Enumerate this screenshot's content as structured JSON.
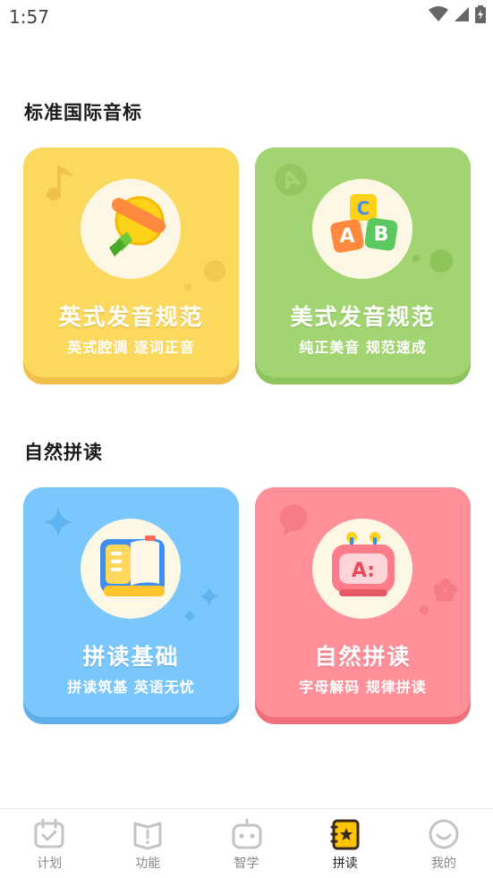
{
  "status_bar": {
    "time": "1:57"
  },
  "sections": [
    {
      "title": "标准国际音标",
      "cards": [
        {
          "title": "英式发音规范",
          "subtitle": "英式腔调 逐词正音",
          "icon": "bell-icon",
          "color": "#fbd95e"
        },
        {
          "title": "美式发音规范",
          "subtitle": "纯正美音 规范速成",
          "icon": "abc-blocks-icon",
          "color": "#a2d572"
        }
      ]
    },
    {
      "title": "自然拼读",
      "cards": [
        {
          "title": "拼读基础",
          "subtitle": "拼读筑基 英语无忧",
          "icon": "book-icon",
          "color": "#79c7fd"
        },
        {
          "title": "自然拼读",
          "subtitle": "字母解码 规律拼读",
          "icon": "robot-icon",
          "color": "#ff909a"
        }
      ]
    }
  ],
  "bottom_nav": {
    "items": [
      {
        "label": "计划",
        "icon": "calendar-check-icon"
      },
      {
        "label": "功能",
        "icon": "book-alert-icon"
      },
      {
        "label": "智学",
        "icon": "robot-face-icon"
      },
      {
        "label": "拼读",
        "icon": "star-book-icon",
        "active": true
      },
      {
        "label": "我的",
        "icon": "smile-icon"
      }
    ]
  }
}
